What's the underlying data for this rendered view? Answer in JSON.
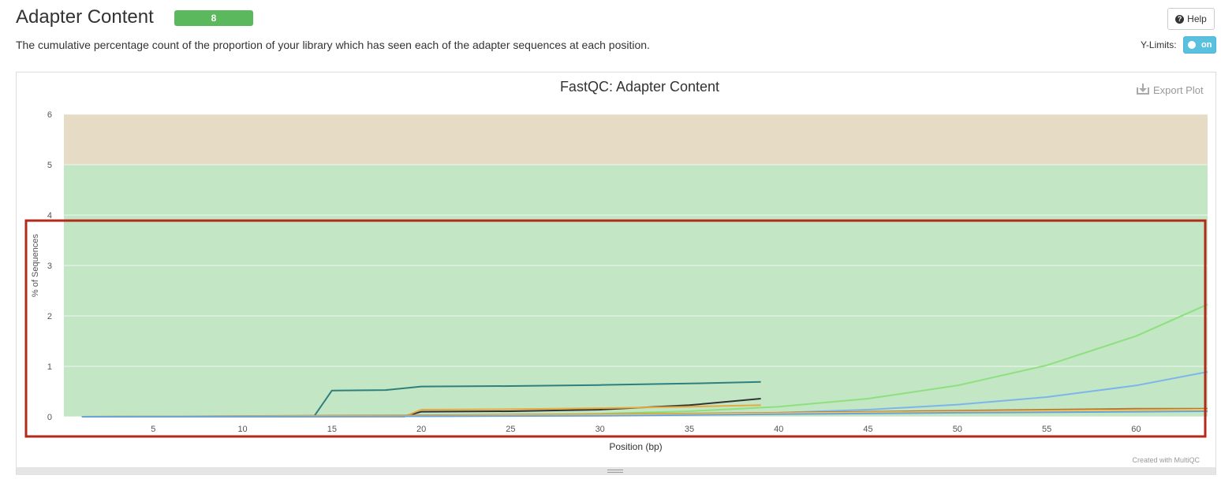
{
  "header": {
    "title": "Adapter Content",
    "badge": "8",
    "description": "The cumulative percentage count of the proportion of your library which has seen each of the adapter sequences at each position.",
    "help_label": "Help",
    "ylimits_label": "Y-Limits:",
    "toggle_label": "on"
  },
  "plot": {
    "export_label": "Export Plot",
    "credit": "Created with MultiQC"
  },
  "colors": {
    "band_warn": "#e6dcc5",
    "band_ok": "#c3e6c5",
    "annotation_box": "#b32a1a"
  },
  "chart_data": {
    "type": "line",
    "title": "FastQC: Adapter Content",
    "xlabel": "Position (bp)",
    "ylabel": "% of Sequences",
    "xlim": [
      0,
      64
    ],
    "ylim": [
      0,
      6
    ],
    "xticks": [
      5,
      10,
      15,
      20,
      25,
      30,
      35,
      40,
      45,
      50,
      55,
      60
    ],
    "yticks": [
      0,
      1,
      2,
      3,
      4,
      5,
      6
    ],
    "grid": true,
    "bands": [
      {
        "from": 0,
        "to": 5,
        "status": "pass"
      },
      {
        "from": 5,
        "to": 6,
        "status": "warn"
      }
    ],
    "series": [
      {
        "color": "#2f7f7f",
        "points": [
          [
            1,
            0
          ],
          [
            10,
            0
          ],
          [
            14,
            0.01
          ],
          [
            15,
            0.52
          ],
          [
            18,
            0.53
          ],
          [
            20,
            0.6
          ],
          [
            25,
            0.61
          ],
          [
            30,
            0.63
          ],
          [
            35,
            0.66
          ],
          [
            39,
            0.69
          ]
        ]
      },
      {
        "color": "#333333",
        "points": [
          [
            1,
            0
          ],
          [
            19,
            0
          ],
          [
            20,
            0.1
          ],
          [
            25,
            0.11
          ],
          [
            30,
            0.14
          ],
          [
            35,
            0.23
          ],
          [
            39,
            0.36
          ]
        ]
      },
      {
        "color": "#e8a93e",
        "points": [
          [
            1,
            0
          ],
          [
            19,
            0
          ],
          [
            20,
            0.14
          ],
          [
            25,
            0.15
          ],
          [
            30,
            0.17
          ],
          [
            35,
            0.2
          ],
          [
            39,
            0.23
          ]
        ]
      },
      {
        "color": "#8de07e",
        "points": [
          [
            1,
            0
          ],
          [
            20,
            0.02
          ],
          [
            30,
            0.06
          ],
          [
            35,
            0.11
          ],
          [
            40,
            0.2
          ],
          [
            45,
            0.36
          ],
          [
            50,
            0.62
          ],
          [
            55,
            1.02
          ],
          [
            60,
            1.6
          ],
          [
            64,
            2.23
          ]
        ]
      },
      {
        "color": "#7cb5ec",
        "points": [
          [
            1,
            0
          ],
          [
            20,
            0.01
          ],
          [
            30,
            0.03
          ],
          [
            40,
            0.08
          ],
          [
            45,
            0.14
          ],
          [
            50,
            0.24
          ],
          [
            55,
            0.39
          ],
          [
            60,
            0.62
          ],
          [
            64,
            0.89
          ]
        ]
      },
      {
        "color": "#b07a3a",
        "points": [
          [
            1,
            0
          ],
          [
            20,
            0.03
          ],
          [
            30,
            0.05
          ],
          [
            40,
            0.08
          ],
          [
            50,
            0.12
          ],
          [
            55,
            0.14
          ],
          [
            60,
            0.16
          ],
          [
            64,
            0.16
          ]
        ]
      },
      {
        "color": "#f7c75c",
        "points": [
          [
            1,
            0
          ],
          [
            20,
            0.02
          ],
          [
            30,
            0.04
          ],
          [
            40,
            0.07
          ],
          [
            50,
            0.1
          ],
          [
            60,
            0.13
          ],
          [
            64,
            0.14
          ]
        ]
      },
      {
        "color": "#6aa4d9",
        "points": [
          [
            1,
            0
          ],
          [
            20,
            0.01
          ],
          [
            30,
            0.02
          ],
          [
            40,
            0.05
          ],
          [
            50,
            0.08
          ],
          [
            60,
            0.1
          ],
          [
            64,
            0.11
          ]
        ]
      }
    ]
  }
}
